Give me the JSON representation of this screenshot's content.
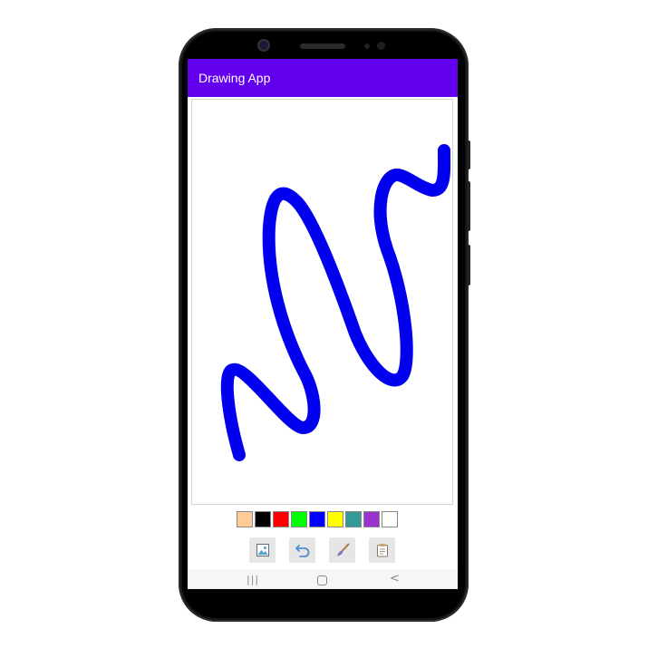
{
  "app": {
    "title": "Drawing App"
  },
  "stroke": {
    "color": "#0000ee"
  },
  "palette": [
    {
      "name": "skin",
      "color": "#ffcc99"
    },
    {
      "name": "black",
      "color": "#000000"
    },
    {
      "name": "red",
      "color": "#ff0000"
    },
    {
      "name": "green",
      "color": "#00ff00"
    },
    {
      "name": "blue",
      "color": "#0000ff"
    },
    {
      "name": "yellow",
      "color": "#ffff00"
    },
    {
      "name": "teal",
      "color": "#339999"
    },
    {
      "name": "purple",
      "color": "#9933cc"
    },
    {
      "name": "white",
      "color": "#ffffff"
    }
  ],
  "toolbar": [
    {
      "icon": "gallery-icon"
    },
    {
      "icon": "undo-icon"
    },
    {
      "icon": "brush-icon"
    },
    {
      "icon": "clipboard-icon"
    }
  ],
  "navigation": {
    "recent": "|||",
    "back": "<"
  }
}
